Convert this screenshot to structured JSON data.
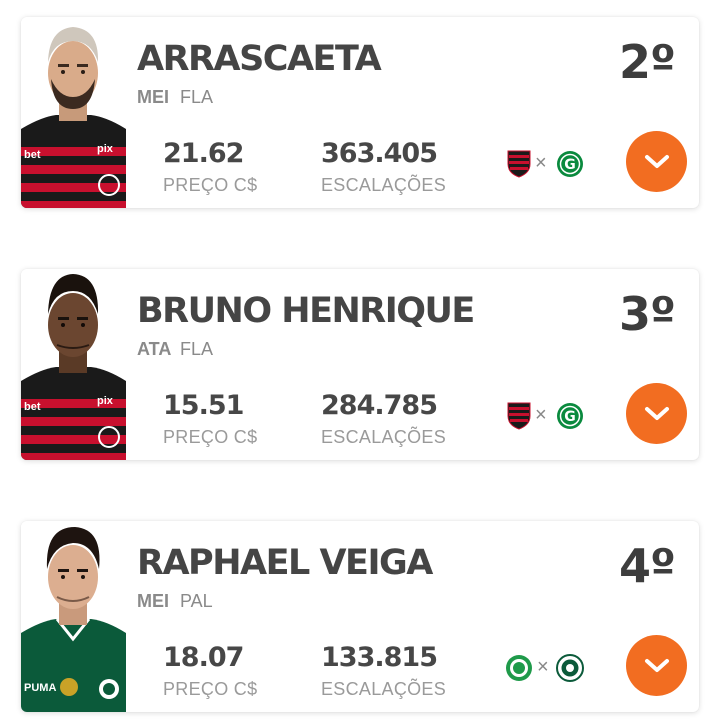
{
  "players": [
    {
      "name": "ARRASCAETA",
      "position": "MEI",
      "club": "FLA",
      "rank": "2º",
      "price": "21.62",
      "price_label": "PREÇO C$",
      "escalacoes": "363.405",
      "escalacoes_label": "ESCALAÇÕES",
      "match_vs": "×",
      "home_crest": "flamengo-crest-icon",
      "away_crest": "goias-crest-icon",
      "kit": "flamengo"
    },
    {
      "name": "BRUNO HENRIQUE",
      "position": "ATA",
      "club": "FLA",
      "rank": "3º",
      "price": "15.51",
      "price_label": "PREÇO C$",
      "escalacoes": "284.785",
      "escalacoes_label": "ESCALAÇÕES",
      "match_vs": "×",
      "home_crest": "flamengo-crest-icon",
      "away_crest": "goias-crest-icon",
      "kit": "flamengo"
    },
    {
      "name": "RAPHAEL VEIGA",
      "position": "MEI",
      "club": "PAL",
      "rank": "4º",
      "price": "18.07",
      "price_label": "PREÇO C$",
      "escalacoes": "133.815",
      "escalacoes_label": "ESCALAÇÕES",
      "match_vs": "×",
      "home_crest": "juventude-crest-icon",
      "away_crest": "palmeiras-crest-icon",
      "kit": "palmeiras"
    }
  ],
  "colors": {
    "accent": "#f26d21",
    "name_text": "#454545",
    "muted_text": "#9a9a9a",
    "flamengo_red": "#c8102e",
    "flamengo_black": "#1a1a1a",
    "palmeiras_green": "#0b5a3a",
    "goias_green": "#0a8a3e"
  }
}
